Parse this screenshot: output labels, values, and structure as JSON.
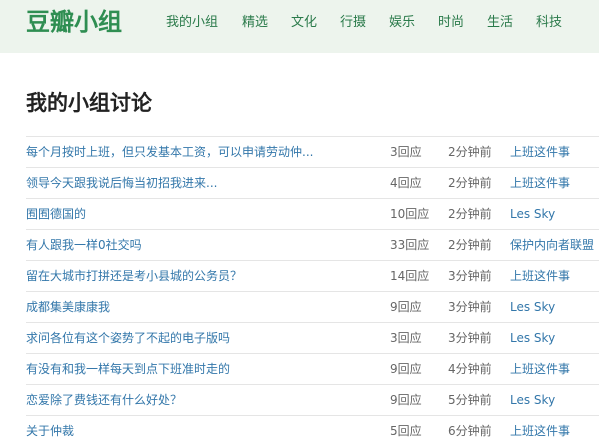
{
  "header": {
    "logo": "豆瓣小组",
    "nav": [
      {
        "label": "我的小组"
      },
      {
        "label": "精选"
      },
      {
        "label": "文化"
      },
      {
        "label": "行摄"
      },
      {
        "label": "娱乐"
      },
      {
        "label": "时尚"
      },
      {
        "label": "生活"
      },
      {
        "label": "科技"
      }
    ]
  },
  "page_title": "我的小组讨论",
  "topics": [
    {
      "title": "每个月按时上班，但只发基本工资，可以申请劳动仲...",
      "replies": "3回应",
      "time": "2分钟前",
      "group": "上班这件事"
    },
    {
      "title": "领导今天跟我说后悔当初招我进来...",
      "replies": "4回应",
      "time": "2分钟前",
      "group": "上班这件事"
    },
    {
      "title": "囿囿德国的",
      "replies": "10回应",
      "time": "2分钟前",
      "group": "Les Sky"
    },
    {
      "title": "有人跟我一样0社交吗",
      "replies": "33回应",
      "time": "2分钟前",
      "group": "保护内向者联盟"
    },
    {
      "title": "留在大城市打拼还是考小县城的公务员？",
      "replies": "14回应",
      "time": "3分钟前",
      "group": "上班这件事"
    },
    {
      "title": "成都集美康康我",
      "replies": "9回应",
      "time": "3分钟前",
      "group": "Les Sky"
    },
    {
      "title": "求问各位有这个姿势了不起的电子版吗",
      "replies": "3回应",
      "time": "3分钟前",
      "group": "Les Sky"
    },
    {
      "title": "有没有和我一样每天到点下班准时走的",
      "replies": "9回应",
      "time": "4分钟前",
      "group": "上班这件事"
    },
    {
      "title": "恋爱除了费钱还有什么好处？",
      "replies": "9回应",
      "time": "5分钟前",
      "group": "Les Sky"
    },
    {
      "title": "关于仲裁",
      "replies": "5回应",
      "time": "6分钟前",
      "group": "上班这件事"
    }
  ],
  "colors": {
    "header_bg": "#edf4ed",
    "logo": "#2f8e52",
    "nav": "#2a7a4a",
    "link": "#3377aa",
    "meta": "#666666"
  }
}
